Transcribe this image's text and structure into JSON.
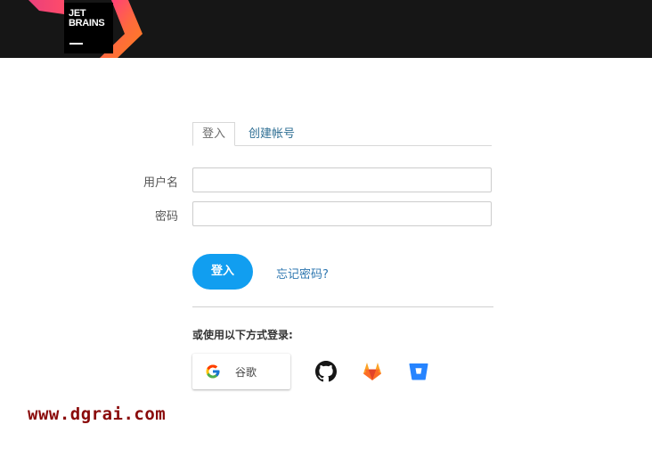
{
  "header": {
    "logo_line1": "JET",
    "logo_line2": "BRAINS",
    "background": "#161616"
  },
  "tabs": [
    {
      "label": "登入",
      "active": true
    },
    {
      "label": "创建帐号",
      "active": false
    }
  ],
  "form": {
    "username_label": "用户名",
    "username_value": "",
    "password_label": "密码",
    "password_value": "",
    "login_button": "登入",
    "forgot_link": "忘记密码?"
  },
  "alt_login": {
    "title": "或使用以下方式登录:",
    "google_label": "谷歌",
    "providers": [
      "github-icon",
      "gitlab-icon",
      "bitbucket-icon"
    ]
  },
  "watermark": "www.dgrai.com",
  "colors": {
    "accent": "#119ef0",
    "link": "#2e77b0",
    "watermark": "#8a0a0a"
  }
}
